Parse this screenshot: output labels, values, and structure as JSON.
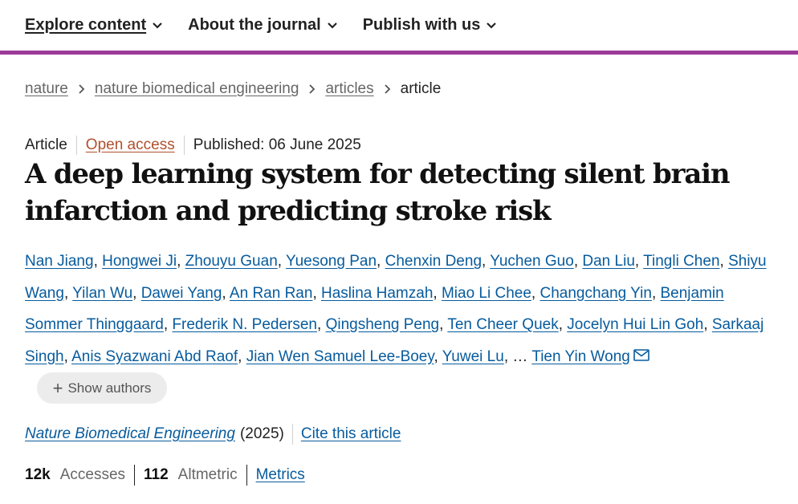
{
  "nav": {
    "items": [
      {
        "label": "Explore content"
      },
      {
        "label": "About the journal"
      },
      {
        "label": "Publish with us"
      }
    ]
  },
  "breadcrumb": {
    "items": [
      "nature",
      "nature biomedical engineering",
      "articles"
    ],
    "current": "article"
  },
  "meta": {
    "type": "Article",
    "access": "Open access",
    "published": "Published: 06 June 2025"
  },
  "title": "A deep learning system for detecting silent brain infarction and predicting stroke risk",
  "authors": [
    "Nan Jiang",
    "Hongwei Ji",
    "Zhouyu Guan",
    "Yuesong Pan",
    "Chenxin Deng",
    "Yuchen Guo",
    "Dan Liu",
    "Tingli Chen",
    "Shiyu Wang",
    "Yilan Wu",
    "Dawei Yang",
    "An Ran Ran",
    "Haslina Hamzah",
    "Miao Li Chee",
    "Changchang Yin",
    "Benjamin Sommer Thinggaard",
    "Frederik N. Pedersen",
    "Qingsheng Peng",
    "Ten Cheer Quek",
    "Jocelyn Hui Lin Goh",
    "Sarkaaj Singh",
    "Anis Syazwani Abd Raof",
    "Jian Wen Samuel Lee-Boey",
    "Yuwei Lu"
  ],
  "authors_ellipsis": "…",
  "last_author": "Tien Yin Wong",
  "show_authors": {
    "icon": "+",
    "label": "Show authors"
  },
  "citation": {
    "journal": "Nature Biomedical Engineering",
    "year": "(2025)",
    "cite_label": "Cite this article"
  },
  "metrics": {
    "accesses_value": "12k",
    "accesses_label": "Accesses",
    "altmetric_value": "112",
    "altmetric_label": "Altmetric",
    "metrics_link": "Metrics"
  },
  "colors": {
    "accent_bar": "#9b3b97",
    "link": "#075b9d",
    "open_access": "#b0502e"
  }
}
